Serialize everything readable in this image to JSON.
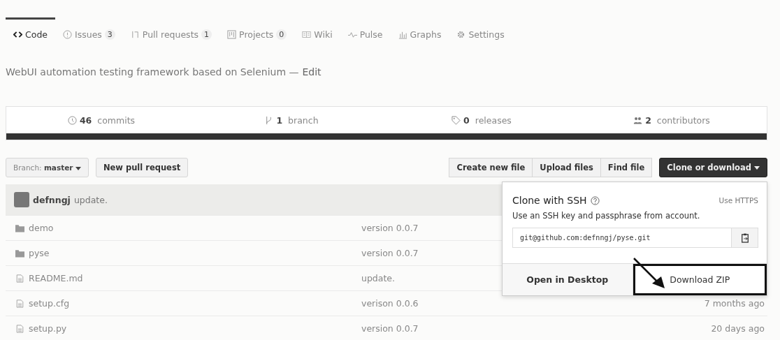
{
  "tabs": [
    {
      "kind": "code",
      "label": "Code",
      "selected": true
    },
    {
      "kind": "issue",
      "label": "Issues",
      "count": "3",
      "selected": false
    },
    {
      "kind": "pr",
      "label": "Pull requests",
      "count": "1",
      "selected": false
    },
    {
      "kind": "project",
      "label": "Projects",
      "count": "0",
      "selected": false
    },
    {
      "kind": "wiki",
      "label": "Wiki",
      "selected": false
    },
    {
      "kind": "pulse",
      "label": "Pulse",
      "selected": false
    },
    {
      "kind": "graph",
      "label": "Graphs",
      "selected": false
    },
    {
      "kind": "gear",
      "label": "Settings",
      "selected": false
    }
  ],
  "description": {
    "text": "WebUI automation testing framework based on Selenium —",
    "edit": "Edit"
  },
  "stats": [
    {
      "kind": "commit",
      "number": "46",
      "label": "commits"
    },
    {
      "kind": "branch",
      "number": "1",
      "label": "branch"
    },
    {
      "kind": "tag",
      "number": "0",
      "label": "releases"
    },
    {
      "kind": "people",
      "number": "2",
      "label": "contributors"
    }
  ],
  "branch_button": {
    "prefix": "Branch:",
    "value": "master"
  },
  "new_pr_button": "New pull request",
  "file_buttons": [
    "Create new file",
    "Upload files",
    "Find file"
  ],
  "clone_button": "Clone or download",
  "commit": {
    "author": "defnngj",
    "message": "update."
  },
  "files": [
    {
      "kind": "folder",
      "name": "demo",
      "message": "version 0.0.7"
    },
    {
      "kind": "folder",
      "name": "pyse",
      "message": "version 0.0.7"
    },
    {
      "kind": "file",
      "name": "README.md",
      "message": "update."
    },
    {
      "kind": "file",
      "name": "setup.cfg",
      "message": "verison 0.0.6",
      "age": "7 months ago"
    },
    {
      "kind": "file",
      "name": "setup.py",
      "message": "version 0.0.7",
      "age": "20 days ago"
    }
  ],
  "clone_popup": {
    "title": "Clone with SSH",
    "switch_link": "Use HTTPS",
    "hint": "Use an SSH key and passphrase from account.",
    "url": "git@github.com:defnngj/pyse.git",
    "buttons": [
      {
        "label": "Open in Desktop",
        "highlighted": false
      },
      {
        "label": "Download ZIP",
        "highlighted": true
      }
    ]
  }
}
